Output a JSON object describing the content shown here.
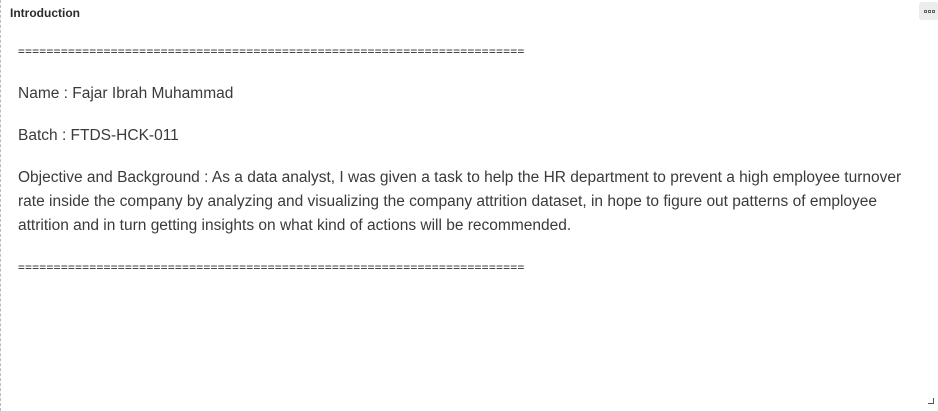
{
  "header": {
    "title": "Introduction",
    "menu_icon": "more-options-icon"
  },
  "content": {
    "rule_top": "=======================================================================",
    "name_line": "Name : Fajar Ibrah Muhammad",
    "batch_line": "Batch : FTDS-HCK-011",
    "objective_line": "Objective and Background : As a data analyst, I was given a task to help the HR department to prevent a high employee turnover rate inside the company by analyzing and visualizing the company attrition dataset, in hope to figure out patterns of employee attrition and in turn getting insights on what kind of actions will be recommended.",
    "rule_bottom": "======================================================================="
  },
  "footer": {
    "resize_icon": "resize-handle-icon"
  }
}
